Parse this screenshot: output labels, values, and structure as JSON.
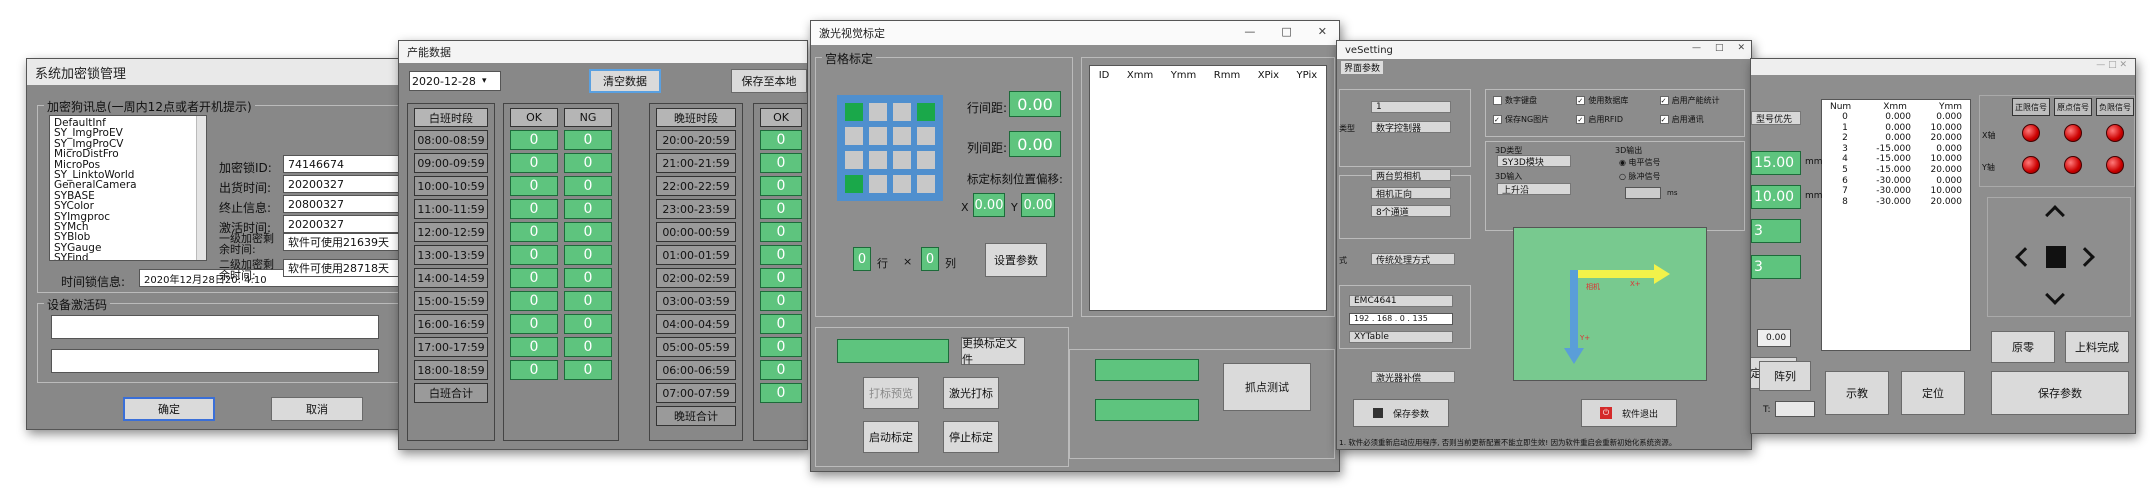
{
  "w1": {
    "title": "系统加密锁管理",
    "group1": "加密狗讯息(一周内12点或者开机提示)",
    "list": [
      "DefaultInf",
      "SY_ImgProEV",
      "SY_ImgProCV",
      "MicroDistFro",
      "MicroPos",
      "SY_LinktoWorld",
      "GeneralCamera",
      "SYBASE",
      "SYColor",
      "SYImgproc",
      "SYMch",
      "SYBlob",
      "SYGauge",
      "SYFind"
    ],
    "fields": [
      {
        "label": "加密锁ID:",
        "value": "74146674"
      },
      {
        "label": "出货时间:",
        "value": "20200327"
      },
      {
        "label": "终止信息:",
        "value": "20800327"
      },
      {
        "label": "激活时间:",
        "value": "20200327"
      },
      {
        "label": "一级加密剩余时间:",
        "value": "软件可使用21639天"
      },
      {
        "label": "二级加密剩余时间:",
        "value": "软件可使用28718天"
      }
    ],
    "lock_label": "时间锁信息:",
    "lock_value": "2020年12月28日20: 4:10",
    "group2": "设备激活码",
    "ok": "确定",
    "cancel": "取消"
  },
  "w2": {
    "title": "产能数据",
    "date": "2020-12-28",
    "clear": "清空数据",
    "save": "保存至本地",
    "col_day": "白班时段",
    "col_ok": "OK",
    "col_ng": "NG",
    "col_night": "晚班时段",
    "col_ok2": "OK",
    "day_slots": [
      "08:00-08:59",
      "09:00-09:59",
      "10:00-10:59",
      "11:00-11:59",
      "12:00-12:59",
      "13:00-13:59",
      "14:00-14:59",
      "15:00-15:59",
      "16:00-16:59",
      "17:00-17:59",
      "18:00-18:59"
    ],
    "night_slots": [
      "20:00-20:59",
      "21:00-21:59",
      "22:00-22:59",
      "23:00-23:59",
      "00:00-00:59",
      "01:00-01:59",
      "02:00-02:59",
      "03:00-03:59",
      "04:00-04:59",
      "05:00-05:59",
      "06:00-06:59",
      "07:00-07:59"
    ],
    "day_total": "白班合计",
    "night_total": "晚班合计",
    "zero": "0"
  },
  "w3": {
    "title": "激光视觉标定",
    "g1": "宫格标定",
    "row_gap": "行间距:",
    "row_gap_v": "0.00",
    "col_gap": "列间距:",
    "col_gap_v": "0.00",
    "offset": "标定标刻位置偏移:",
    "x": "X",
    "x_v": "0.00",
    "y": "Y",
    "y_v": "0.00",
    "rows": "0",
    "row_t": "行",
    "cols": "0",
    "col_t": "列",
    "set": "设置参数",
    "table_cols": [
      "ID",
      "Xmm",
      "Ymm",
      "Rmm",
      "XPix",
      "YPix"
    ],
    "replace": "更换标定文件",
    "preview": "打标预览",
    "laser": "激光打标",
    "start": "启动标定",
    "stop": "停止标定",
    "grab": "抓点测试",
    "max": "□",
    "close": "✕"
  },
  "w4": {
    "title": "veSetting",
    "tab": "界面参数",
    "type_lbl": "类型",
    "type_v": "数字控制器",
    "opt1": "1",
    "camlist": "两台剪相机",
    "cam2": "相机正向",
    "chan": "8个通道",
    "mode_lbl": "式",
    "mode_v": "传统处理方式",
    "ctrl": "EMC4641",
    "ip": "192 . 168 . 0 . 135",
    "table": "XYTable",
    "laser_mode": "激光器补偿",
    "checks": [
      "数字键盘",
      "使用数据库",
      "启用产能统计",
      "保存NG图片",
      "启用RFID",
      "启用通讯"
    ],
    "typ3d": "3D类型",
    "typ3d_v": "SY3D模块",
    "in3d": "3D输入",
    "in3d_v": "上升沿",
    "out3d": "3D输出",
    "radio1": "电平信号",
    "radio2": "脉冲信号",
    "ms": "ms",
    "label_x": "X+",
    "label_y": "Y+",
    "label_cam": "相机",
    "save": "保存参数",
    "exit": "软件退出",
    "note": "1. 软件必须重新启动应用程序, 否则当前更新配置不能立即生效! 因为软件重启会重新初始化系统资源。"
  },
  "w5": {
    "title": "",
    "sel": "型号优先",
    "vals": [
      "15.00",
      "10.00",
      "3",
      "3"
    ],
    "v5": "0.00",
    "unit": "mm",
    "cols": [
      "Num",
      "Xmm",
      "Ymm"
    ],
    "rows": [
      [
        "0",
        "0.000",
        "0.000"
      ],
      [
        "1",
        "0.000",
        "10.000"
      ],
      [
        "2",
        "0.000",
        "20.000"
      ],
      [
        "3",
        "-15.000",
        "0.000"
      ],
      [
        "4",
        "-15.000",
        "10.000"
      ],
      [
        "5",
        "-15.000",
        "20.000"
      ],
      [
        "6",
        "-30.000",
        "0.000"
      ],
      [
        "7",
        "-30.000",
        "10.000"
      ],
      [
        "8",
        "-30.000",
        "20.000"
      ]
    ],
    "hdr": [
      "正限信号",
      "原点信号",
      "负限信号"
    ],
    "axis": [
      "X轴",
      "Y轴"
    ],
    "origin": "原零",
    "feed": "上料完成",
    "demo": "示教",
    "pos": "定位",
    "save": "保存参数",
    "array": "阵列",
    "pick": "定点位",
    "t": "T:",
    "ctl": "—  □  ✕"
  }
}
